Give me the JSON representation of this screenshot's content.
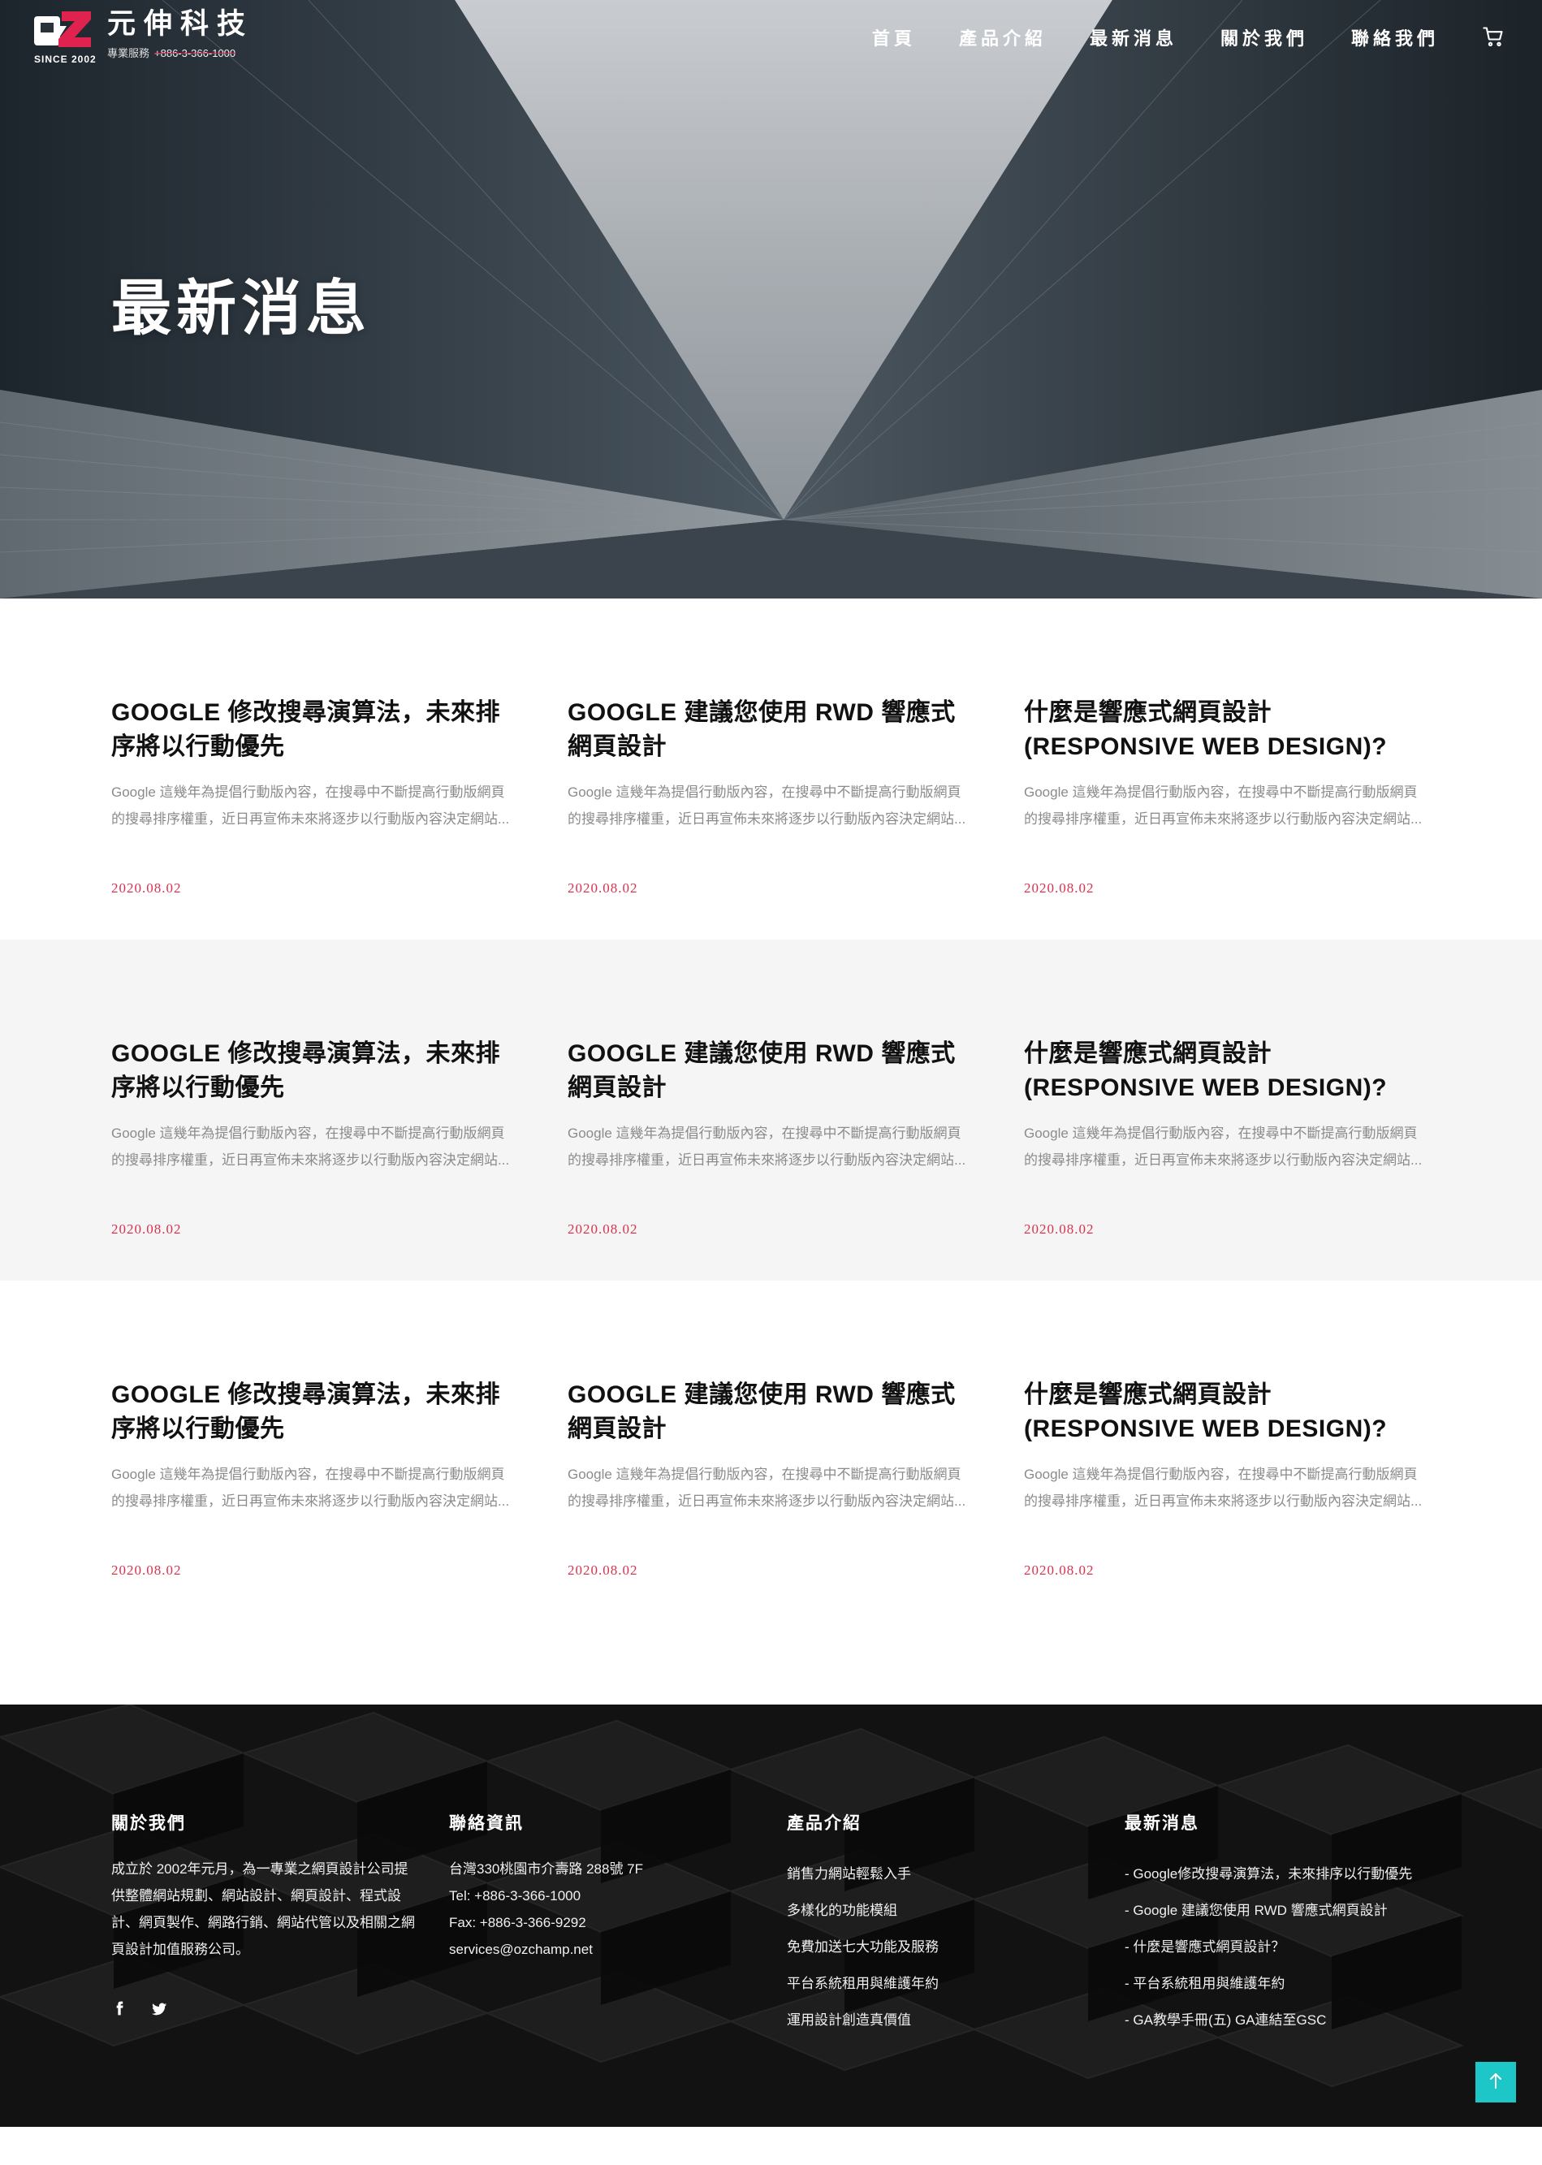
{
  "brand": {
    "logo_letters": "OZ",
    "since": "SINCE 2002",
    "name": "元伸科技",
    "service_label": "專業服務",
    "service_phone": "+886-3-366-1000"
  },
  "nav": {
    "items": [
      {
        "label": "首頁"
      },
      {
        "label": "產品介紹"
      },
      {
        "label": "最新消息"
      },
      {
        "label": "關於我們"
      },
      {
        "label": "聯絡我們"
      }
    ],
    "cart_icon": "cart-icon"
  },
  "hero": {
    "title": "最新消息"
  },
  "news": {
    "rows": [
      {
        "cards": [
          {
            "title": "GOOGLE 修改搜尋演算法，未來排序將以行動優先",
            "excerpt": "Google 這幾年為提倡行動版內容，在搜尋中不斷提高行動版網頁的搜尋排序權重，近日再宣佈未來將逐步以行動版內容決定網站...",
            "date": "2020.08.02"
          },
          {
            "title": "GOOGLE 建議您使用 RWD 響應式網頁設計",
            "excerpt": "Google 這幾年為提倡行動版內容，在搜尋中不斷提高行動版網頁的搜尋排序權重，近日再宣佈未來將逐步以行動版內容決定網站...",
            "date": "2020.08.02"
          },
          {
            "title": "什麼是響應式網頁設計 (RESPONSIVE WEB DESIGN)?",
            "excerpt": "Google 這幾年為提倡行動版內容，在搜尋中不斷提高行動版網頁的搜尋排序權重，近日再宣佈未來將逐步以行動版內容決定網站...",
            "date": "2020.08.02"
          }
        ]
      },
      {
        "cards": [
          {
            "title": "GOOGLE 修改搜尋演算法，未來排序將以行動優先",
            "excerpt": "Google 這幾年為提倡行動版內容，在搜尋中不斷提高行動版網頁的搜尋排序權重，近日再宣佈未來將逐步以行動版內容決定網站...",
            "date": "2020.08.02"
          },
          {
            "title": "GOOGLE 建議您使用 RWD 響應式網頁設計",
            "excerpt": "Google 這幾年為提倡行動版內容，在搜尋中不斷提高行動版網頁的搜尋排序權重，近日再宣佈未來將逐步以行動版內容決定網站...",
            "date": "2020.08.02"
          },
          {
            "title": "什麼是響應式網頁設計 (RESPONSIVE WEB DESIGN)?",
            "excerpt": "Google 這幾年為提倡行動版內容，在搜尋中不斷提高行動版網頁的搜尋排序權重，近日再宣佈未來將逐步以行動版內容決定網站...",
            "date": "2020.08.02"
          }
        ]
      },
      {
        "cards": [
          {
            "title": "GOOGLE 修改搜尋演算法，未來排序將以行動優先",
            "excerpt": "Google 這幾年為提倡行動版內容，在搜尋中不斷提高行動版網頁的搜尋排序權重，近日再宣佈未來將逐步以行動版內容決定網站...",
            "date": "2020.08.02"
          },
          {
            "title": "GOOGLE 建議您使用 RWD 響應式網頁設計",
            "excerpt": "Google 這幾年為提倡行動版內容，在搜尋中不斷提高行動版網頁的搜尋排序權重，近日再宣佈未來將逐步以行動版內容決定網站...",
            "date": "2020.08.02"
          },
          {
            "title": "什麼是響應式網頁設計 (RESPONSIVE WEB DESIGN)?",
            "excerpt": "Google 這幾年為提倡行動版內容，在搜尋中不斷提高行動版網頁的搜尋排序權重，近日再宣佈未來將逐步以行動版內容決定網站...",
            "date": "2020.08.02"
          }
        ]
      }
    ]
  },
  "footer": {
    "about": {
      "heading": "關於我們",
      "text": "成立於 2002年元月，為一專業之網頁設計公司提供整體網站規劃、網站設計、網頁設計、程式設計、網頁製作、網路行銷、網站代管以及相關之網頁設計加值服務公司。",
      "social_icons": [
        "facebook-icon",
        "twitter-icon"
      ]
    },
    "contact": {
      "heading": "聯絡資訊",
      "address": "台灣330桃園市介壽路 288號 7F",
      "tel": "Tel: +886-3-366-1000",
      "fax": "Fax: +886-3-366-9292",
      "email": "services@ozchamp.net"
    },
    "products": {
      "heading": "產品介紹",
      "items": [
        "銷售力網站輕鬆入手",
        "多樣化的功能模組",
        "免費加送七大功能及服務",
        "平台系統租用與維護年約",
        "運用設計創造真價值"
      ]
    },
    "news": {
      "heading": "最新消息",
      "items": [
        "- Google修改搜尋演算法，未來排序以行動優先",
        "- Google 建議您使用 RWD 響應式網頁設計",
        "- 什麼是響應式網頁設計？",
        "- 平台系統租用與維護年約",
        "- GA教學手冊(五) GA連結至GSC"
      ]
    },
    "to_top_icon": "arrow-up-icon"
  },
  "colors": {
    "accent": "#d8324f",
    "to_top": "#1ec7c7",
    "alt_row": "#f5f5f5",
    "footer_bg": "#1f1f1f"
  }
}
